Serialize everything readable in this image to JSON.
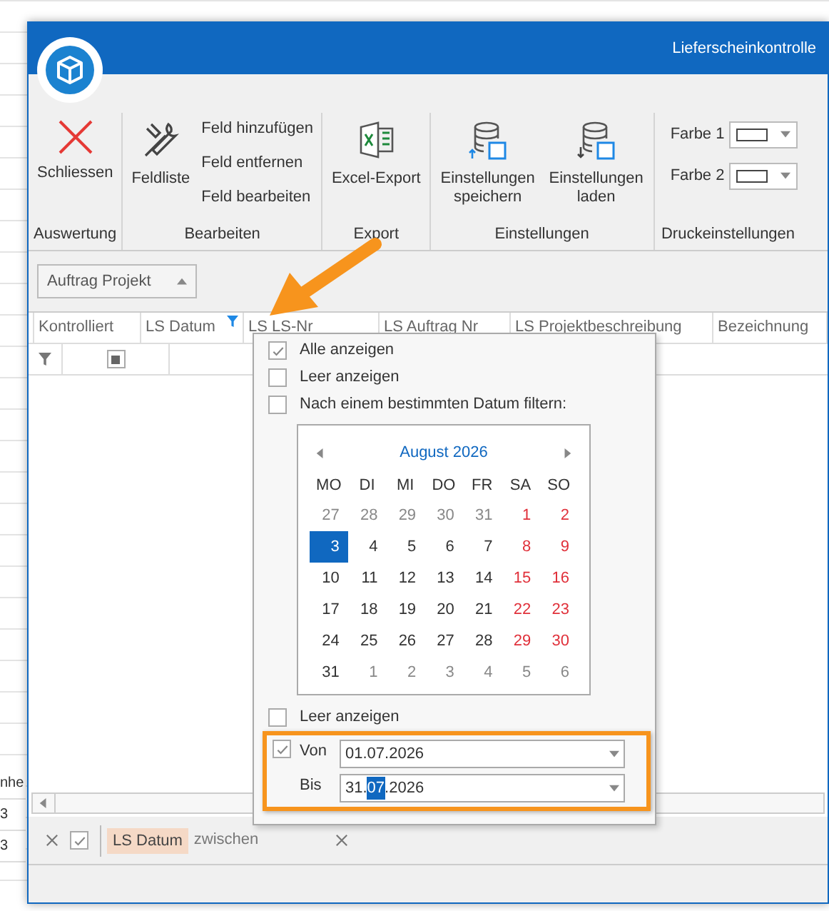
{
  "background_sheet": {
    "cells": [
      "nhe",
      "3",
      "3"
    ]
  },
  "window": {
    "title": "Lieferscheinkontrolle"
  },
  "ribbon": {
    "groups": [
      {
        "label": "Auswertung",
        "items": [
          {
            "kind": "large",
            "label": "Schliessen"
          }
        ]
      },
      {
        "label": "Bearbeiten",
        "items": [
          {
            "kind": "large",
            "label": "Feldliste"
          },
          {
            "kind": "small",
            "label": "Feld hinzufügen"
          },
          {
            "kind": "small",
            "label": "Feld entfernen"
          },
          {
            "kind": "small",
            "label": "Feld bearbeiten"
          }
        ]
      },
      {
        "label": "Export",
        "items": [
          {
            "kind": "large",
            "label": "Excel-Export"
          }
        ]
      },
      {
        "label": "Einstellungen",
        "items": [
          {
            "kind": "large",
            "label": "Einstellungen speichern"
          },
          {
            "kind": "large",
            "label": "Einstellungen laden"
          }
        ]
      },
      {
        "label": "Druckeinstellungen",
        "items": [
          {
            "kind": "color",
            "label": "Farbe 1"
          },
          {
            "kind": "color",
            "label": "Farbe 2"
          }
        ]
      }
    ]
  },
  "group_panel": {
    "label": "Auftrag Projekt"
  },
  "grid": {
    "columns": [
      {
        "label": "Kontrolliert",
        "filtered": false
      },
      {
        "label": "LS Datum",
        "filtered": true
      },
      {
        "label": "LS LS-Nr",
        "filtered": false
      },
      {
        "label": "LS Auftrag Nr",
        "filtered": false
      },
      {
        "label": "LS Projektbeschreibung",
        "filtered": false
      },
      {
        "label": "Bezeichnung",
        "filtered": false
      }
    ],
    "filter_row": {
      "kontrolliert_indeterminate": true
    }
  },
  "filter_popup": {
    "options": [
      {
        "label": "Alle anzeigen",
        "checked": true
      },
      {
        "label": "Leer anzeigen",
        "checked": false
      },
      {
        "label": "Nach einem bestimmten Datum filtern:",
        "checked": false
      }
    ],
    "calendar": {
      "month": "August 2026",
      "weekdays": [
        "MO",
        "DI",
        "MI",
        "DO",
        "FR",
        "SA",
        "SO"
      ],
      "weeks": [
        [
          {
            "day": "27",
            "kind": "other",
            "selected": false
          },
          {
            "day": "28",
            "kind": "other",
            "selected": false
          },
          {
            "day": "29",
            "kind": "other",
            "selected": false
          },
          {
            "day": "30",
            "kind": "other",
            "selected": false
          },
          {
            "day": "31",
            "kind": "other",
            "selected": false
          },
          {
            "day": "1",
            "kind": "weekend",
            "selected": false
          },
          {
            "day": "2",
            "kind": "weekend",
            "selected": false
          }
        ],
        [
          {
            "day": "3",
            "kind": "current",
            "selected": true
          },
          {
            "day": "4",
            "kind": "current",
            "selected": false
          },
          {
            "day": "5",
            "kind": "current",
            "selected": false
          },
          {
            "day": "6",
            "kind": "current",
            "selected": false
          },
          {
            "day": "7",
            "kind": "current",
            "selected": false
          },
          {
            "day": "8",
            "kind": "weekend",
            "selected": false
          },
          {
            "day": "9",
            "kind": "weekend",
            "selected": false
          }
        ],
        [
          {
            "day": "10",
            "kind": "current",
            "selected": false
          },
          {
            "day": "11",
            "kind": "current",
            "selected": false
          },
          {
            "day": "12",
            "kind": "current",
            "selected": false
          },
          {
            "day": "13",
            "kind": "current",
            "selected": false
          },
          {
            "day": "14",
            "kind": "current",
            "selected": false
          },
          {
            "day": "15",
            "kind": "weekend",
            "selected": false
          },
          {
            "day": "16",
            "kind": "weekend",
            "selected": false
          }
        ],
        [
          {
            "day": "17",
            "kind": "current",
            "selected": false
          },
          {
            "day": "18",
            "kind": "current",
            "selected": false
          },
          {
            "day": "19",
            "kind": "current",
            "selected": false
          },
          {
            "day": "20",
            "kind": "current",
            "selected": false
          },
          {
            "day": "21",
            "kind": "current",
            "selected": false
          },
          {
            "day": "22",
            "kind": "weekend",
            "selected": false
          },
          {
            "day": "23",
            "kind": "weekend",
            "selected": false
          }
        ],
        [
          {
            "day": "24",
            "kind": "current",
            "selected": false
          },
          {
            "day": "25",
            "kind": "current",
            "selected": false
          },
          {
            "day": "26",
            "kind": "current",
            "selected": false
          },
          {
            "day": "27",
            "kind": "current",
            "selected": false
          },
          {
            "day": "28",
            "kind": "current",
            "selected": false
          },
          {
            "day": "29",
            "kind": "weekend",
            "selected": false
          },
          {
            "day": "30",
            "kind": "weekend",
            "selected": false
          }
        ],
        [
          {
            "day": "31",
            "kind": "current",
            "selected": false
          },
          {
            "day": "1",
            "kind": "other",
            "selected": false
          },
          {
            "day": "2",
            "kind": "other",
            "selected": false
          },
          {
            "day": "3",
            "kind": "other",
            "selected": false
          },
          {
            "day": "4",
            "kind": "other",
            "selected": false
          },
          {
            "day": "5",
            "kind": "other",
            "selected": false
          },
          {
            "day": "6",
            "kind": "other",
            "selected": false
          }
        ]
      ]
    },
    "empty_option": {
      "label": "Leer anzeigen",
      "checked": false
    },
    "range": {
      "checked": true,
      "from": {
        "label": "Von",
        "value_parts": [
          {
            "text": "01.07.2026",
            "selected": false
          }
        ]
      },
      "to": {
        "label": "Bis",
        "value_parts": [
          {
            "text": "31.",
            "selected": false
          },
          {
            "text": "07",
            "selected": true
          },
          {
            "text": ".2026",
            "selected": false
          }
        ]
      }
    }
  },
  "filter_panel": {
    "enabled": true,
    "field": "LS Datum",
    "operator": "zwischen"
  }
}
